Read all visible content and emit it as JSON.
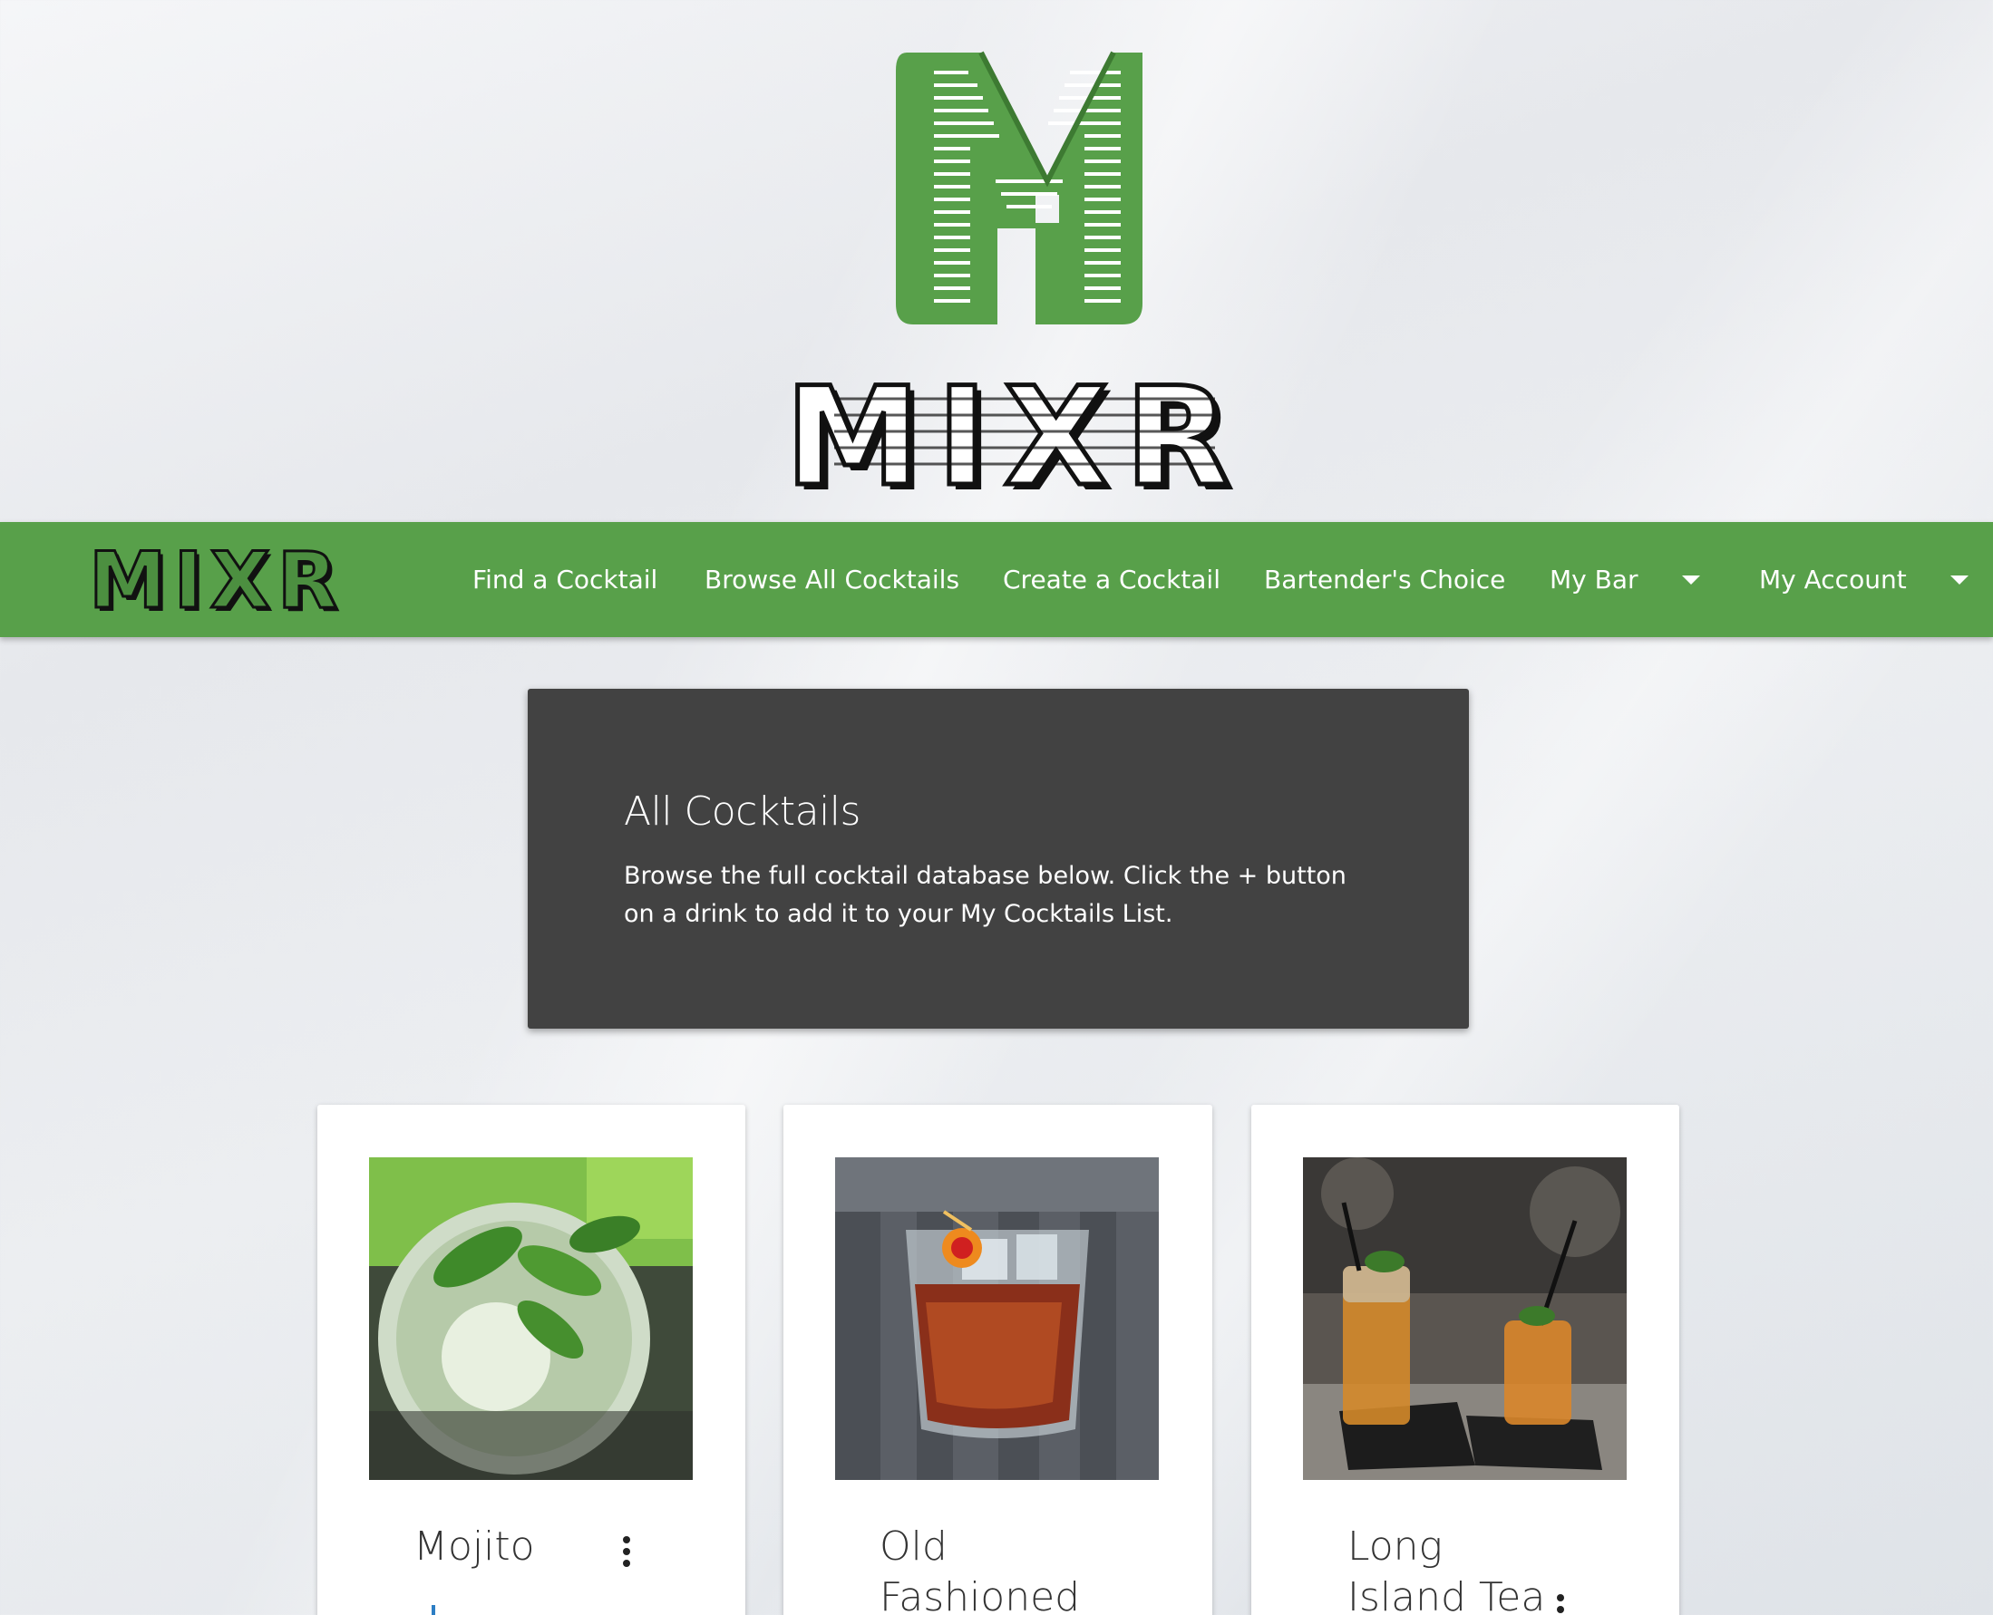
{
  "brand": {
    "name": "MIXR",
    "logo_color": "#58a04a"
  },
  "nav": {
    "items": [
      {
        "label": "Find a Cocktail"
      },
      {
        "label": "Browse All Cocktails"
      },
      {
        "label": "Create a Cocktail"
      },
      {
        "label": "Bartender's Choice"
      },
      {
        "label": "My Bar",
        "dropdown": true
      },
      {
        "label": "My Account",
        "dropdown": true
      }
    ]
  },
  "intro": {
    "title": "All Cocktails",
    "text": "Browse the full cocktail database below. Click the + button on a drink to add it to your My Cocktails List."
  },
  "cards": [
    {
      "name": "Mojito",
      "photo_icon": "mojito-photo"
    },
    {
      "name": "Old Fashioned",
      "photo_icon": "old-fashioned-photo"
    },
    {
      "name": "Long Island Tea",
      "photo_icon": "long-island-photo"
    }
  ],
  "colors": {
    "nav_bg": "#58a04a",
    "panel_bg": "#424242",
    "accent_blue": "#2d7ec4"
  }
}
